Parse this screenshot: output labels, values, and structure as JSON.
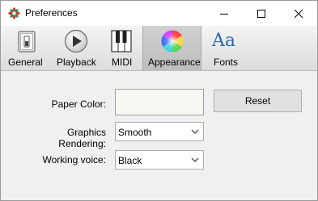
{
  "window": {
    "title": "Preferences"
  },
  "toolbar": {
    "tabs": [
      {
        "label": "General",
        "icon": "toggle-switch-icon"
      },
      {
        "label": "Playback",
        "icon": "play-icon"
      },
      {
        "label": "MIDI",
        "icon": "piano-keys-icon"
      },
      {
        "label": "Appearance",
        "icon": "color-wheel-icon",
        "selected": true
      },
      {
        "label": "Fonts",
        "icon": "font-aa-icon",
        "glyph": "Aa"
      }
    ]
  },
  "appearance": {
    "paper_color_label": "Paper Color:",
    "paper_color_value": "#f8f7f2",
    "reset_label": "Reset",
    "graphics_rendering_label": "Graphics Rendering:",
    "graphics_rendering_value": "Smooth",
    "working_voice_label": "Working voice:",
    "working_voice_value": "Black"
  }
}
